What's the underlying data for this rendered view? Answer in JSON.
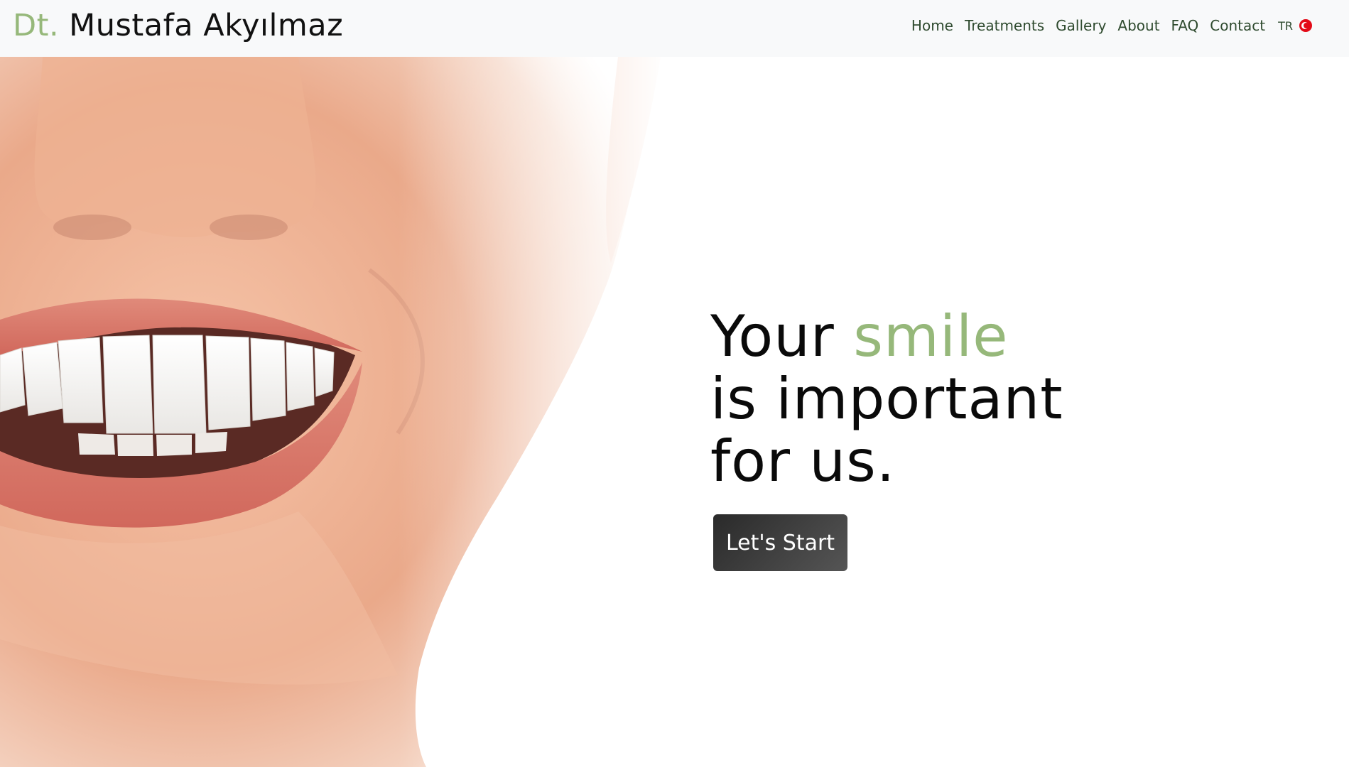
{
  "brand": {
    "prefix": "Dt.",
    "name": "Mustafa Akyılmaz"
  },
  "nav": {
    "items": [
      {
        "label": "Home"
      },
      {
        "label": "Treatments"
      },
      {
        "label": "Gallery"
      },
      {
        "label": "About"
      },
      {
        "label": "FAQ"
      },
      {
        "label": "Contact"
      }
    ],
    "language": {
      "label": "TR",
      "flag_icon": "turkey-flag-icon"
    }
  },
  "hero": {
    "headline_line1_prefix": "Your",
    "headline_line1_accent": "smile",
    "headline_line2": "is important",
    "headline_line3": "for us.",
    "cta_label": "Let's Start",
    "image": "smiling-woman-teeth-closeup"
  },
  "colors": {
    "accent_green": "#96b87a",
    "nav_link": "#2e4a2e",
    "navbar_bg": "#f8f9fa",
    "cta_bg": "#3a3a3a",
    "flag_red": "#e30a17"
  }
}
